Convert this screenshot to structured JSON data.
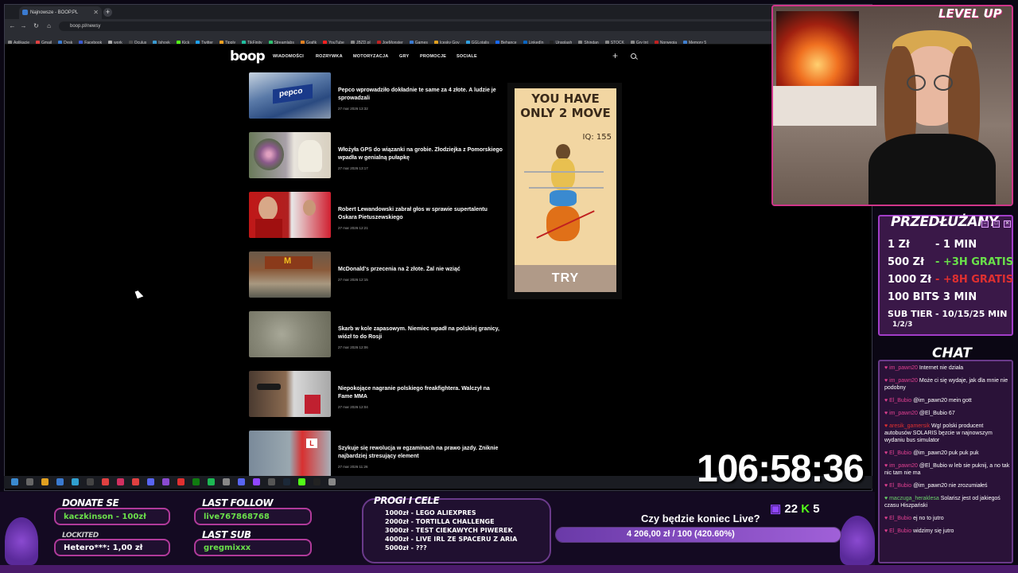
{
  "browser": {
    "tab_title": "Najnowsze - BOOP.PL",
    "url": "boop.pl/newsy",
    "bookmarks": [
      "Aplikacje",
      "Gmail",
      "Dysk",
      "Facebook",
      "work",
      "Oculus",
      "Ishovk",
      "Kick",
      "Twitter",
      "Tipply",
      "TikFinity",
      "Streamlabs",
      "Grafik",
      "YouTube",
      "JBZD.pl",
      "JoeMonster",
      "Games",
      "Icesky Gov",
      "GGLotalis",
      "Behance",
      "LinkedIn",
      "Unsplash",
      "Shindan",
      "STOCK",
      "Gry tnt",
      "Norwegia",
      "Memory 5"
    ]
  },
  "site": {
    "logo": "boop",
    "nav": [
      "WIADOMOŚCI",
      "ROZRYWKA",
      "MOTORYZACJA",
      "GRY",
      "PROMOCJE",
      "SOCIALE"
    ]
  },
  "articles": [
    {
      "title": "Pepco wprowadziło dokładnie te same za 4 złote. A ludzie je sprowadzali",
      "date": "27 mar 2026 13:32"
    },
    {
      "title": "Włożyła GPS do wiązanki na grobie. Złodziejka z Pomorskiego wpadła w genialną pułapkę",
      "date": "27 mar 2026 13:17"
    },
    {
      "title": "Robert Lewandowski zabrał głos w sprawie supertalentu Oskara Pietuszewskiego",
      "date": "27 mar 2026 12:21"
    },
    {
      "title": "McDonald's przecenia na 2 złote. Żal nie wziąć",
      "date": "27 mar 2026 12:15"
    },
    {
      "title": "Skarb w kole zapasowym. Niemiec wpadł na polskiej granicy, wiózł to do Rosji",
      "date": "27 mar 2026 12:06"
    },
    {
      "title": "Niepokojące nagranie polskiego freakfightera. Walczył na Fame MMA",
      "date": "27 mar 2026 12:04"
    },
    {
      "title": "Szykuje się rewolucja w egzaminach na prawo jazdy. Zniknie najbardziej stresujący element",
      "date": "27 mar 2026 11:26"
    }
  ],
  "ad": {
    "headline_1": "YOU HAVE",
    "headline_2": "ONLY 2 MOVE",
    "iq": "IQ: 155",
    "cta": "TRY"
  },
  "overlay": {
    "brand": "LEVEL UP",
    "brand_sub": "PRZEDŁUŻANY",
    "sub_title": "PRZEDŁUŻANY",
    "sub_rows": [
      {
        "label": "1 Zł",
        "value": "- 1 MIN",
        "color": "#ffffff"
      },
      {
        "label": "500 Zł",
        "value": "- +3H GRATIS",
        "color": "#6ae04a"
      },
      {
        "label": "1000 Zł",
        "value": "- +8H GRATIS",
        "color": "#e03030"
      },
      {
        "label": "100 BITS",
        "value": "- 3 MIN",
        "color": "#ffffff"
      },
      {
        "label": "SUB TIER",
        "value": "- 10/15/25 MIN",
        "color": "#ffffff"
      }
    ],
    "sub_tier_sub": "1/2/3",
    "chat_title": "CHAT",
    "chat": [
      {
        "user": "im_pawn20",
        "msg": "Internet nie działa",
        "cls": ""
      },
      {
        "user": "im_pawn20",
        "msg": "Może ci się wydaje, jak dla mnie nie podobny",
        "cls": ""
      },
      {
        "user": "El_Bubio",
        "msg": "@im_pawn20 mein gott",
        "cls": ""
      },
      {
        "user": "im_pawn20",
        "msg": "@El_Bubio 67",
        "cls": ""
      },
      {
        "user": "aresik_gamersik",
        "msg": "Wg! polski producent autobusów SOLARIS bęzcie w najnowszym wydaniu bus simulator",
        "cls": "red"
      },
      {
        "user": "El_Bubio",
        "msg": "@im_pawn20 puk puk puk",
        "cls": ""
      },
      {
        "user": "im_pawn20",
        "msg": "@El_Bubio w leb sie puknij, a no tak nic tam nie ma",
        "cls": ""
      },
      {
        "user": "El_Bubio",
        "msg": "@im_pawn20 nie zrozumiałeś",
        "cls": ""
      },
      {
        "user": "maczuga_heraklesa",
        "msg": "Solarisz jest od jakiegoś czasu Hiszpański",
        "cls": "green"
      },
      {
        "user": "El_Bubio",
        "msg": "ej no to jutro",
        "cls": ""
      },
      {
        "user": "El_Bubio",
        "msg": "widzimy się jutro",
        "cls": ""
      }
    ],
    "timer": "106:58:36",
    "donate_title": "DONATE SE",
    "donate_val": "kaczkinson - 100zł",
    "donate2_label": "LOCKITED",
    "donate2_val": "Hetero***: 1,00 zł",
    "follow_title": "LAST FOLLOW",
    "follow_val": "live767868768",
    "sub_last_title": "LAST SUB",
    "sub_last_val": "gregmixxx",
    "goals_title": "PROGI I CELE",
    "goals": [
      "1000zł - LEGO ALIEXPRES",
      "2000zł - TORTILLA CHALLENGE",
      "3000zł - TEST CIEKAWYCH PIWEREK",
      "4000zł - LIVE IRL ZE SPACERU Z ARIA",
      "5000zł - ???"
    ],
    "live_question": "Czy będzie koniec Live?",
    "progress_text": "4 206,00 zł / 100",
    "progress_pct_text": "(420.60%)",
    "progress_fraction": 1.0,
    "viewers": "22",
    "kick_count": "5"
  }
}
